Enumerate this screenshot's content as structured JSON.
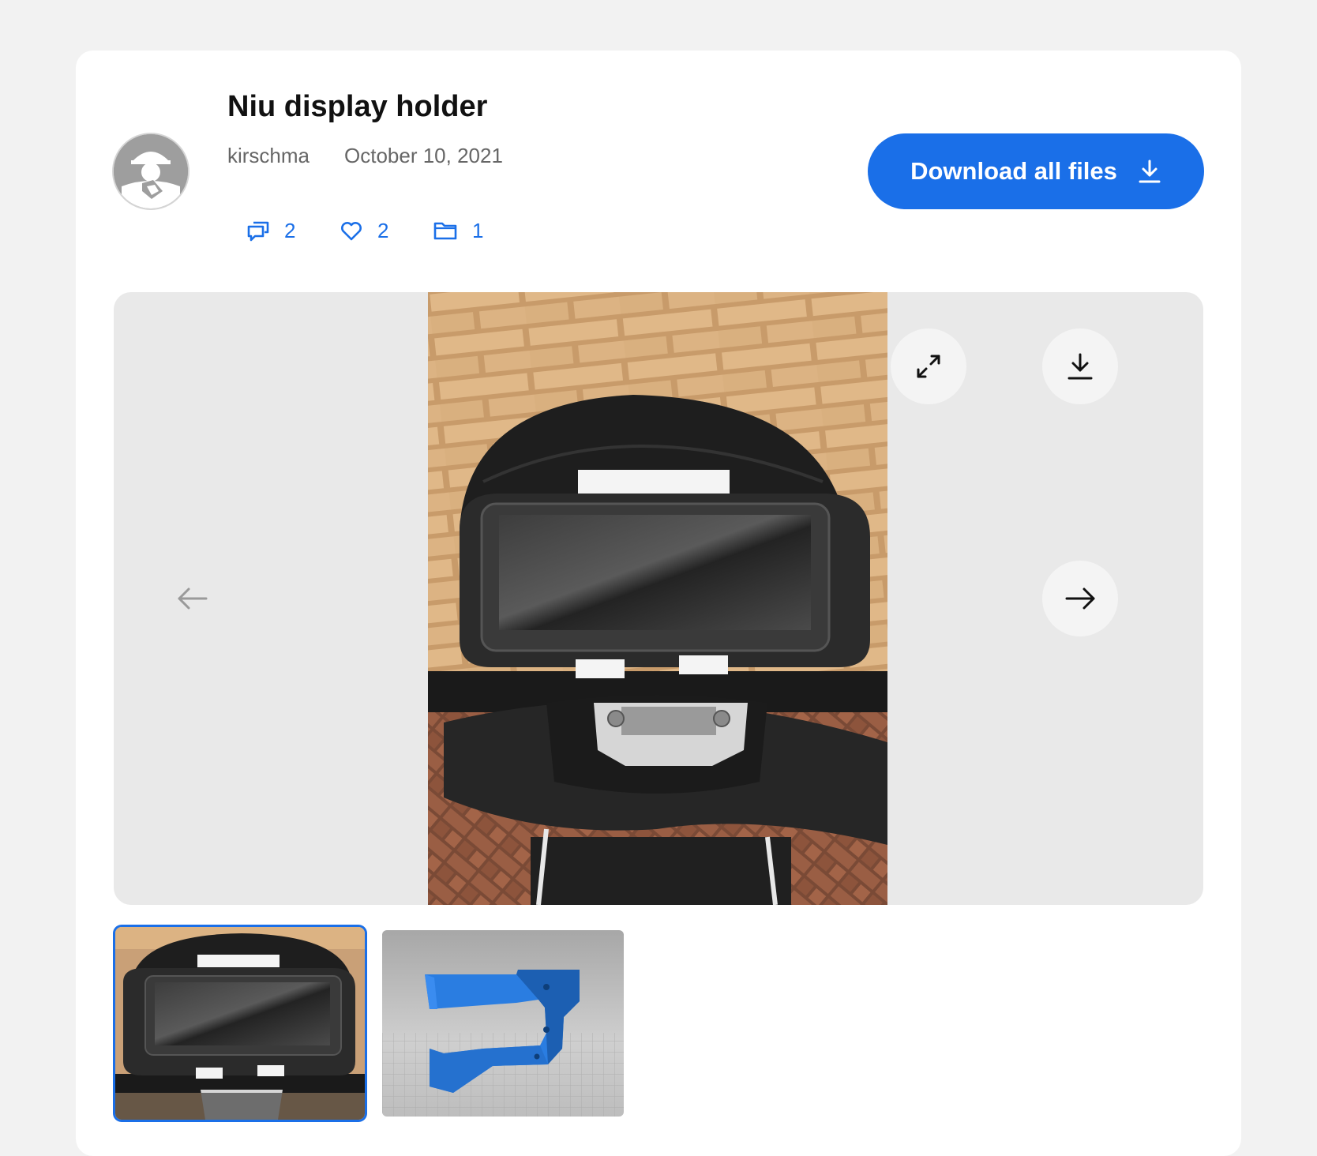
{
  "thing": {
    "title": "Niu display holder",
    "author": "kirschma",
    "date": "October 10, 2021"
  },
  "stats": {
    "comments": "2",
    "likes": "2",
    "files": "1"
  },
  "actions": {
    "download_all_label": "Download all files"
  },
  "viewer": {
    "icons": [
      "fullscreen-icon",
      "download-icon",
      "arrow-left-icon",
      "arrow-right-icon"
    ],
    "thumbnails": [
      {
        "name": "photo of display holder on scooter",
        "selected": true
      },
      {
        "name": "3D render of blue holder",
        "selected": false
      }
    ]
  },
  "colors": {
    "accent": "#1a6fe8",
    "viewer_bg": "#e9e9e9",
    "page_bg": "#f2f2f2"
  }
}
